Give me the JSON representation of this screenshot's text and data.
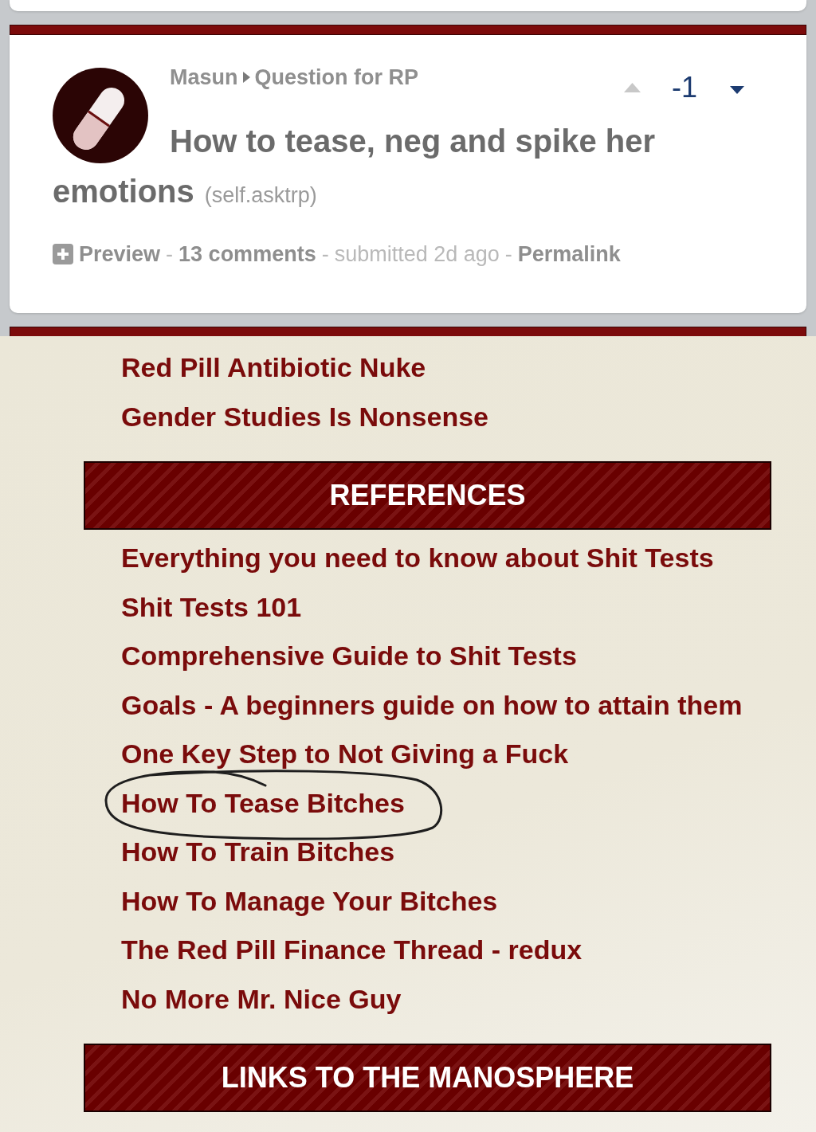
{
  "post": {
    "author": "Masun",
    "category": "Question for RP",
    "upvoted": false,
    "downvoted": true,
    "score": "-1",
    "title_lines": [
      "How to tease, neg and spike her",
      "emotions"
    ],
    "domain": "(self.asktrp)",
    "actions": [
      {
        "kind": "expand",
        "label": "Preview"
      },
      {
        "kind": "separator",
        "label": "-"
      },
      {
        "kind": "link",
        "label": "13 comments"
      },
      {
        "kind": "separator",
        "label": "-"
      },
      {
        "kind": "info",
        "label": "submitted 2d ago"
      },
      {
        "kind": "separator",
        "label": "-"
      },
      {
        "kind": "link",
        "label": "Permalink"
      }
    ]
  },
  "sidebar": {
    "links": [
      {
        "label": "Red Pill Antibiotic Nuke",
        "circled": false
      },
      {
        "label": "Gender Studies Is Nonsense",
        "circled": false
      }
    ],
    "sections": [
      {
        "heading": "REFERENCES",
        "links": [
          {
            "label": "Everything you need to know about Shit Tests",
            "circled": false
          },
          {
            "label": "Shit Tests 101",
            "circled": false
          },
          {
            "label": "Comprehensive Guide to Shit Tests",
            "circled": false
          },
          {
            "label": "Goals - A beginners guide on how to attain them",
            "circled": false
          },
          {
            "label": "One Key Step to Not Giving a Fuck",
            "circled": false
          },
          {
            "label": "How To Tease Bitches",
            "circled": true
          },
          {
            "label": "How To Train Bitches",
            "circled": false
          },
          {
            "label": "How To Manage Your Bitches",
            "circled": false
          },
          {
            "label": "The Red Pill Finance Thread - redux",
            "circled": false
          },
          {
            "label": "No More Mr. Nice Guy",
            "circled": false
          }
        ]
      },
      {
        "heading": "LINKS TO THE MANOSPHERE"
      }
    ]
  }
}
